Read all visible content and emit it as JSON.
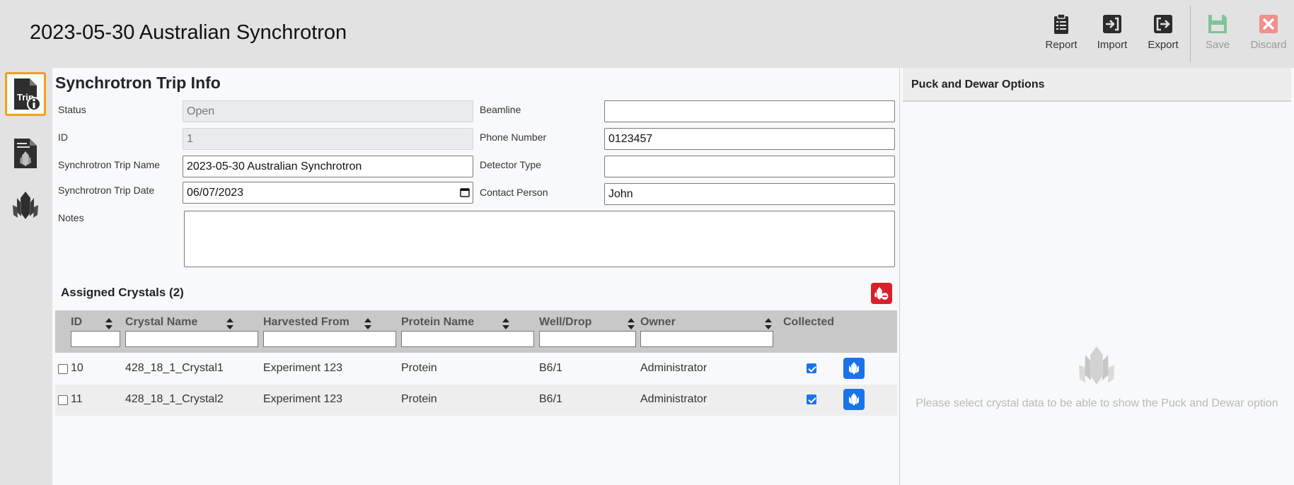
{
  "header": {
    "title": "2023-05-30 Australian Synchrotron",
    "toolbar": {
      "report": "Report",
      "import": "Import",
      "export": "Export",
      "save": "Save",
      "discard": "Discard"
    }
  },
  "nav": {
    "trip_label": "Trip"
  },
  "trip_info": {
    "title": "Synchrotron Trip Info",
    "status_label": "Status",
    "status_value": "Open",
    "id_label": "ID",
    "id_value": "1",
    "name_label": "Synchrotron Trip Name",
    "name_value": "2023-05-30 Australian Synchrotron",
    "date_label": "Synchrotron Trip Date",
    "date_value": "06/07/2023",
    "notes_label": "Notes",
    "notes_value": "",
    "beamline_label": "Beamline",
    "beamline_value": "",
    "phone_label": "Phone Number",
    "phone_value": "0123457",
    "detector_label": "Detector Type",
    "detector_value": "",
    "contact_label": "Contact Person",
    "contact_value": "John"
  },
  "assigned": {
    "title": "Assigned Crystals (2)",
    "columns": {
      "id": "ID",
      "crystal_name": "Crystal Name",
      "harvested_from": "Harvested From",
      "protein_name": "Protein Name",
      "well_drop": "Well/Drop",
      "owner": "Owner",
      "collected": "Collected"
    },
    "rows": [
      {
        "id": "10",
        "crystal_name": "428_18_1_Crystal1",
        "harvested_from": "Experiment 123",
        "protein_name": "Protein",
        "well_drop": "B6/1",
        "owner": "Administrator",
        "collected": true
      },
      {
        "id": "11",
        "crystal_name": "428_18_1_Crystal2",
        "harvested_from": "Experiment 123",
        "protein_name": "Protein",
        "well_drop": "B6/1",
        "owner": "Administrator",
        "collected": true
      }
    ]
  },
  "puck_panel": {
    "title": "Puck and Dewar Options",
    "empty_message": "Please select crystal data to be able to show the Puck and Dewar option"
  },
  "colors": {
    "header_bg": "#e2e2e2",
    "active_nav_border": "#f0a020",
    "primary": "#1a73e8",
    "danger": "#d9202b",
    "save_green": "#7ec49a",
    "discard_red": "#ef8f8f"
  }
}
